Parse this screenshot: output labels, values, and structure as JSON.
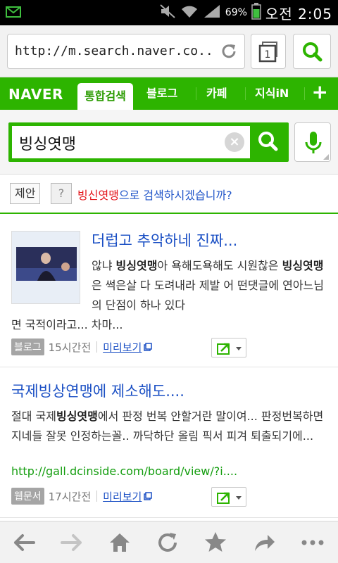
{
  "status_bar": {
    "battery_pct": "69%",
    "time": "오전 2:05",
    "icons": [
      "mail-icon",
      "mute-icon",
      "wifi-icon",
      "signal-icon",
      "battery-icon"
    ]
  },
  "browser": {
    "url": "http://m.search.naver.co...",
    "tab_count": "1"
  },
  "naver_nav": {
    "logo": "NAVER",
    "tabs": [
      {
        "label": "통합검색",
        "active": true
      },
      {
        "label": "블로그"
      },
      {
        "label": "카페"
      },
      {
        "label": "지식iN"
      }
    ],
    "more": "+"
  },
  "search": {
    "query": "빙싱엿맹",
    "clear": "×"
  },
  "suggestion": {
    "tag": "제안",
    "help": "?",
    "corrected": "빙신엿맹",
    "rest": "으로 검색하시겠습니까?"
  },
  "results": [
    {
      "title": "더럽고 추악하네 진짜...",
      "snippet_head": [
        "않냐 ",
        "빙싱엿맹",
        "아 욕해도욕해도 시원찮은 ",
        "빙싱엿맹",
        "은 썩은살 다 도려내라 제발 어 떤댓글에 연아느님의 단점이 하나 있다"
      ],
      "snippet_tail": "면 국적이라고... 차마...",
      "type": "블로그",
      "ago": "15시간전",
      "preview": "미리보기"
    },
    {
      "title": "국제빙상연맹에 제소해도....",
      "snippet": [
        "절대 국제",
        "빙싱엿맹",
        "에서 판정 번복 안할거란 말이여... 판정번복하면 지네들 잘못 인정하는꼴.. 까닥하단 올림 픽서 피겨 퇴출되기에..."
      ],
      "url": "http://gall.dcinside.com/board/view/?i....",
      "type": "웹문서",
      "ago": "17시간전",
      "preview": "미리보기"
    }
  ],
  "colors": {
    "naver_green": "#2db400",
    "link_blue": "#1a4fc4",
    "url_green": "#139d0e",
    "suggest_red": "#e4191e"
  }
}
